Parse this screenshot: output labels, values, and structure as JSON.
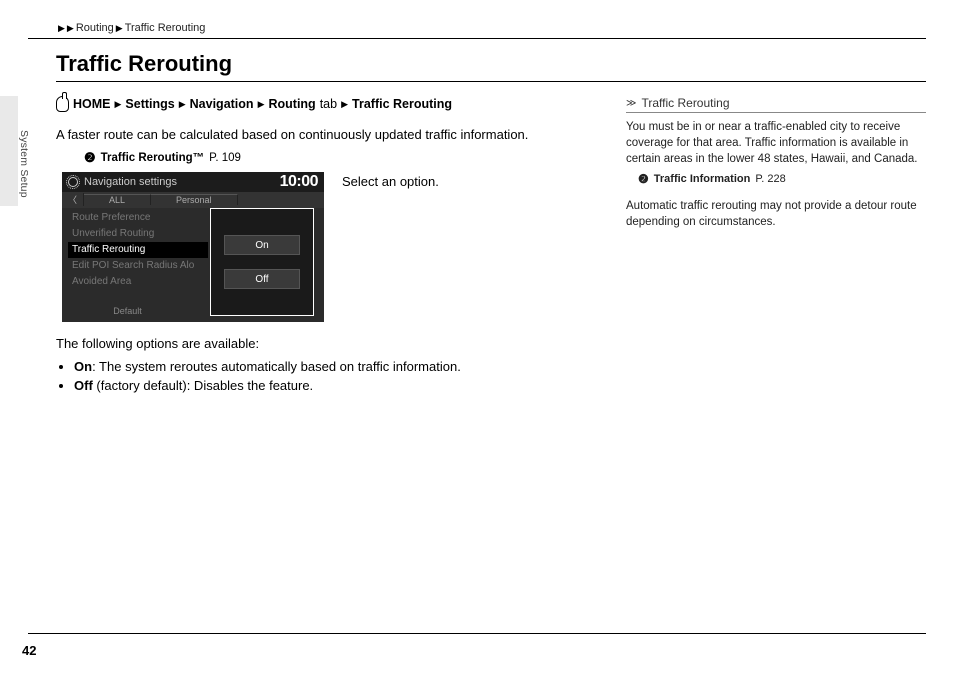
{
  "breadcrumb": {
    "a": "Routing",
    "b": "Traffic Rerouting"
  },
  "side_section": "System Setup",
  "title": "Traffic Rerouting",
  "menu_path": {
    "home": "HOME",
    "settings": "Settings",
    "navigation": "Navigation",
    "routing": "Routing",
    "tab_word": "tab",
    "leaf": "Traffic Rerouting"
  },
  "intro": "A faster route can be calculated based on continuously updated traffic information.",
  "xref1": {
    "label": "Traffic Rerouting™",
    "page": "P. 109"
  },
  "screenshot": {
    "header": "Navigation settings",
    "clock": "10:00",
    "tab_all": "ALL",
    "tab_personal": "Personal",
    "items": {
      "i0": "Route Preference",
      "i1": "Unverified Routing",
      "i2": "Traffic Rerouting",
      "i3": "Edit POI Search Radius Alo",
      "i4": "Avoided Area"
    },
    "footer_default": "Default",
    "popup": {
      "on": "On",
      "off": "Off"
    }
  },
  "step_text": "Select an option.",
  "options_intro": "The following options are available:",
  "options": {
    "on": {
      "label": "On",
      "text": ": The system reroutes automatically based on traffic information."
    },
    "off": {
      "label": "Off",
      "text": " (factory default): Disables the feature."
    }
  },
  "sidenote": {
    "heading": "Traffic Rerouting",
    "p1": "You must be in or near a traffic-enabled city to receive coverage for that area. Traffic information is available in certain areas in the lower 48 states, Hawaii, and Canada.",
    "xref": {
      "label": "Traffic Information",
      "page": "P. 228"
    },
    "p2": "Automatic traffic rerouting may not provide a detour route depending on circumstances."
  },
  "page_number": "42"
}
